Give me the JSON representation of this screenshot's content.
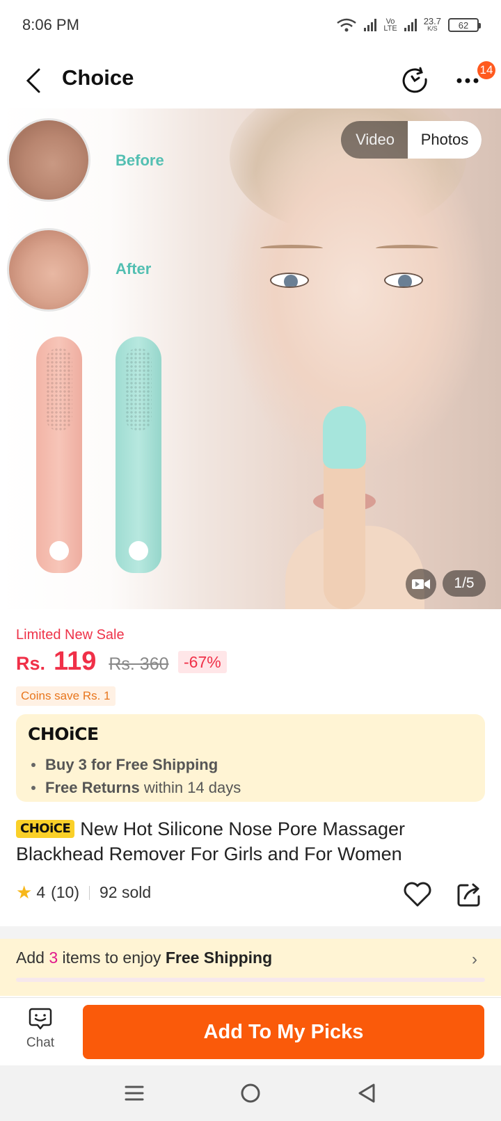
{
  "status_bar": {
    "time": "8:06 PM",
    "network_top": "Vo",
    "network_bottom": "LTE",
    "speed_value": "23.7",
    "speed_unit": "K/S",
    "battery": "62"
  },
  "header": {
    "title": "Choice",
    "badge_count": "14",
    "icons": [
      "back-arrow",
      "history",
      "more-dots"
    ]
  },
  "gallery": {
    "before_label": "Before",
    "after_label": "After",
    "tab_video": "Video",
    "tab_photos": "Photos",
    "active_tab": "Photos",
    "counter": "1/5"
  },
  "pricing": {
    "sale_label": "Limited New Sale",
    "currency": "Rs.",
    "price": "119",
    "original_price": "Rs. 360",
    "discount": "-67%",
    "coins": "Coins save Rs. 1"
  },
  "choice_box": {
    "logo": "CHOiCE",
    "line1_bold": "Buy 3 for  Free Shipping",
    "line2_bold": "Free Returns",
    "line2_rest": " within 14 days"
  },
  "product": {
    "tag": "CHOiCE",
    "title": "New Hot Silicone Nose Pore Massager Blackhead Remover For Girls and For Women",
    "rating": "4",
    "reviews": "(10)",
    "sold": "92 sold"
  },
  "shipping_bar": {
    "prefix": "Add ",
    "count": "3",
    "middle": " items to enjoy ",
    "bold": "Free Shipping",
    "chevron": "›"
  },
  "actions": {
    "chat_label": "Chat",
    "add_label": "Add To My Picks"
  },
  "colors": {
    "accent_orange": "#fa5a0a",
    "price_red": "#f03048",
    "choice_yellow": "#fad028",
    "choice_bg": "#fff4d4"
  }
}
